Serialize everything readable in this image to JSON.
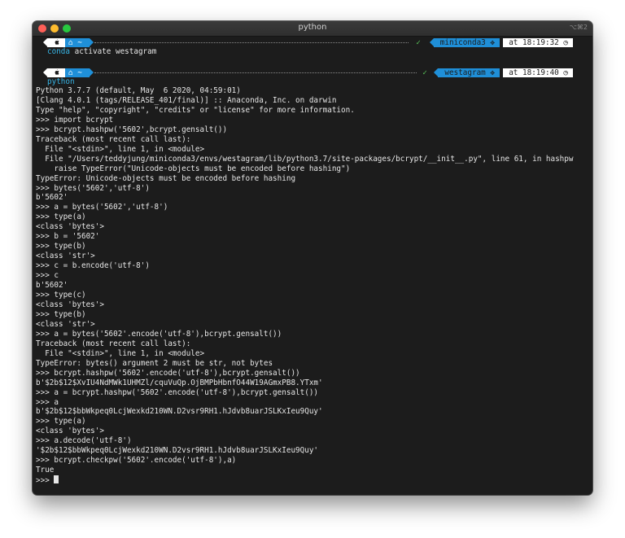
{
  "window": {
    "title": "python",
    "shortcut": "⌥⌘2"
  },
  "prompts": [
    {
      "dir_label": "~",
      "env": "miniconda3",
      "time": "at 18:19:32",
      "command_keyword": "conda",
      "command_rest": " activate westagram"
    },
    {
      "dir_label": "~",
      "env": "westagram",
      "time": "at 18:19:40",
      "command_keyword": "python",
      "command_rest": ""
    }
  ],
  "icons": {
    "apple": "apple-icon",
    "home": "home-icon",
    "check": "check-icon",
    "clock": "clock-icon",
    "env_glyph": "python-env-icon"
  },
  "colors": {
    "accent_blue": "#1f8fd8",
    "check_green": "#5ac35a",
    "keyword_cyan": "#37b5e6"
  },
  "output_lines": [
    "Python 3.7.7 (default, May  6 2020, 04:59:01)",
    "[Clang 4.0.1 (tags/RELEASE_401/final)] :: Anaconda, Inc. on darwin",
    "Type \"help\", \"copyright\", \"credits\" or \"license\" for more information.",
    ">>> import bcrypt",
    ">>> bcrypt.hashpw('5602',bcrypt.gensalt())",
    "Traceback (most recent call last):",
    "  File \"<stdin>\", line 1, in <module>",
    "  File \"/Users/teddyjung/miniconda3/envs/westagram/lib/python3.7/site-packages/bcrypt/__init__.py\", line 61, in hashpw",
    "    raise TypeError(\"Unicode-objects must be encoded before hashing\")",
    "TypeError: Unicode-objects must be encoded before hashing",
    ">>> bytes('5602','utf-8')",
    "b'5602'",
    ">>> a = bytes('5602','utf-8')",
    ">>> type(a)",
    "<class 'bytes'>",
    ">>> b = '5602'",
    ">>> type(b)",
    "<class 'str'>",
    ">>> c = b.encode('utf-8')",
    ">>> c",
    "b'5602'",
    ">>> type(c)",
    "<class 'bytes'>",
    ">>> type(b)",
    "<class 'str'>",
    ">>> a = bytes('5602'.encode('utf-8'),bcrypt.gensalt())",
    "Traceback (most recent call last):",
    "  File \"<stdin>\", line 1, in <module>",
    "TypeError: bytes() argument 2 must be str, not bytes",
    ">>> bcrypt.hashpw('5602'.encode('utf-8'),bcrypt.gensalt())",
    "b'$2b$12$XvIU4NdMWk1UHMZl/cquVuQp.OjBMPbHbnfO44W19AGmxPB8.YTxm'",
    ">>> a = bcrypt.hashpw('5602'.encode('utf-8'),bcrypt.gensalt())",
    ">>> a",
    "b'$2b$12$bbWkpeq0LcjWexkd210WN.D2vsr9RH1.hJdvb8uarJSLKxIeu9Quy'",
    ">>> type(a)",
    "<class 'bytes'>",
    ">>> a.decode('utf-8')",
    "'$2b$12$bbWkpeq0LcjWexkd210WN.D2vsr9RH1.hJdvb8uarJSLKxIeu9Quy'",
    ">>> bcrypt.checkpw('5602'.encode('utf-8'),a)",
    "True"
  ],
  "current_prompt": ">>> "
}
